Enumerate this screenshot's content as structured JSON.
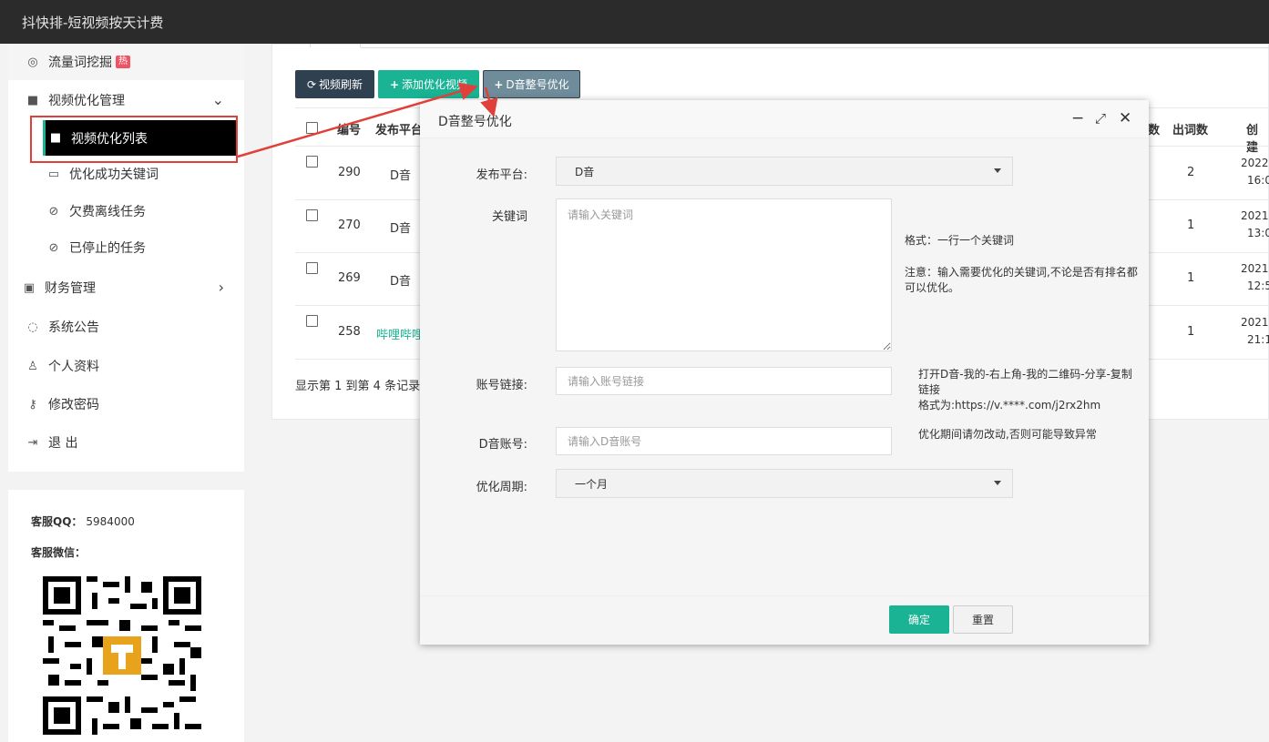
{
  "app": {
    "title": "抖快排-短视频按天计费"
  },
  "sidebar": {
    "items": [
      {
        "label": "流量词挖掘",
        "badge": "热",
        "icon": "target-icon"
      },
      {
        "label": "视频优化管理",
        "icon": "video-camera-icon"
      },
      {
        "label": "视频优化列表",
        "icon": "video-camera-icon"
      },
      {
        "label": "优化成功关键词",
        "icon": "inbox-icon"
      },
      {
        "label": "欠费离线任务",
        "icon": "ban-icon"
      },
      {
        "label": "已停止的任务",
        "icon": "ban-icon"
      },
      {
        "label": "财务管理",
        "icon": "money-icon"
      },
      {
        "label": "系统公告",
        "icon": "comment-icon"
      },
      {
        "label": "个人资料",
        "icon": "user-icon"
      },
      {
        "label": "修改密码",
        "icon": "key-icon"
      },
      {
        "label": "退 出",
        "icon": "sign-out-icon"
      }
    ]
  },
  "service": {
    "qq_label": "客服QQ：",
    "qq_value": "5984000",
    "wechat_label": "客服微信："
  },
  "toolbar": {
    "refresh": "视频刷新",
    "add": "添加优化视频",
    "whole": "D音整号优化"
  },
  "table": {
    "headers": [
      "编号",
      "发布平台",
      "数",
      "出词数",
      "创建"
    ],
    "rows": [
      {
        "id": "290",
        "platform": "D音",
        "count": "2",
        "date1": "2022-",
        "date2": "16:0"
      },
      {
        "id": "270",
        "platform": "D音",
        "count": "1",
        "date1": "2021-",
        "date2": "13:0"
      },
      {
        "id": "269",
        "platform": "D音",
        "count": "1",
        "date1": "2021-",
        "date2": "12:5"
      },
      {
        "id": "258",
        "platform": "哔哩哔哩",
        "count": "1",
        "date1": "2021-",
        "date2": "21:1"
      }
    ],
    "footer": "显示第 1 到第 4 条记录"
  },
  "modal": {
    "title": "D音整号优化",
    "platform_label": "发布平台:",
    "platform_value": "D音",
    "keyword_label": "关键词",
    "keyword_placeholder": "请输入关键词",
    "keyword_hint1": "格式：一行一个关键词",
    "keyword_hint2": "注意：输入需要优化的关键词,不论是否有排名都可以优化。",
    "account_link_label": "账号链接:",
    "account_link_placeholder": "请输入账号链接",
    "account_link_hint1": "打开D音-我的-右上角-我的二维码-分享-复制链接",
    "account_link_hint2": "格式为:https://v.****.com/j2rx2hm",
    "account_label": "D音账号:",
    "account_placeholder": "请输入D音账号",
    "account_hint": "优化期间请勿改动,否则可能导致异常",
    "period_label": "优化周期:",
    "period_value": "一个月",
    "ok": "确定",
    "reset": "重置",
    "minimize_icon": "minimize-icon",
    "maximize_icon": "maximize-icon",
    "close_icon": "close-icon"
  },
  "colors": {
    "primary": "#1ab394",
    "dark": "#2f4050",
    "annotation": "#e0403a"
  }
}
